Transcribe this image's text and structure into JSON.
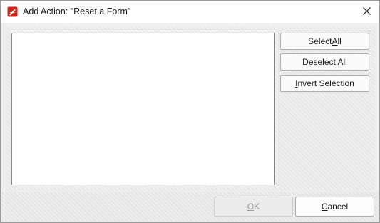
{
  "window": {
    "title": "Add Action: \"Reset a Form\"",
    "icon": "pdf-app-icon",
    "close_icon": "close-icon"
  },
  "fields_list": {
    "items": []
  },
  "side_buttons": {
    "select_all": {
      "before": "Select ",
      "mnemonic": "A",
      "after": "ll"
    },
    "deselect_all": {
      "before": "",
      "mnemonic": "D",
      "after": "eselect All"
    },
    "invert_selection": {
      "before": "",
      "mnemonic": "I",
      "after": "nvert Selection"
    }
  },
  "footer": {
    "ok": {
      "before": "",
      "mnemonic": "O",
      "after": "K",
      "disabled": true
    },
    "cancel": {
      "before": "",
      "mnemonic": "C",
      "after": "ancel"
    }
  },
  "colors": {
    "icon_red": "#c8281e",
    "ok_disabled_text": "#9a9a9a"
  }
}
